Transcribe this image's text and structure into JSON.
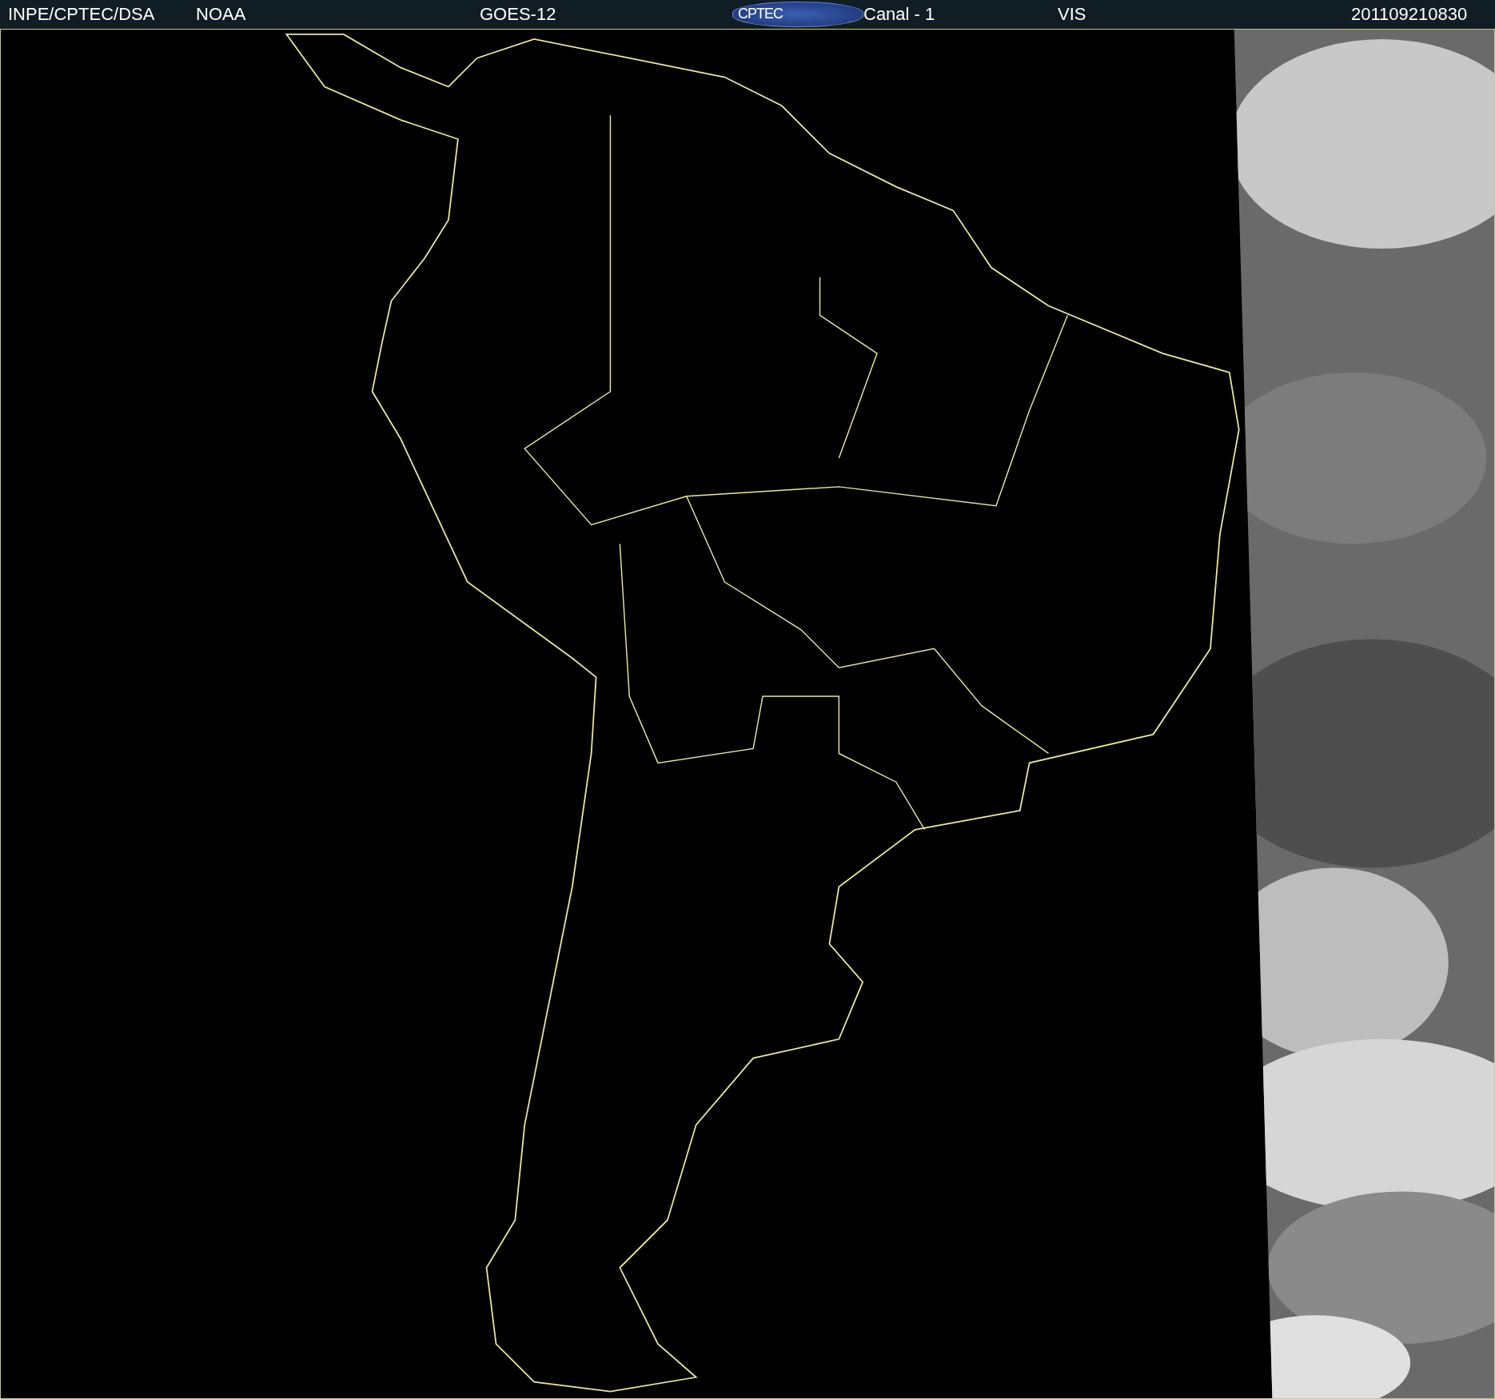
{
  "header": {
    "items": [
      {
        "text": "INPE/CPTEC/DSA"
      },
      {
        "text": "NOAA"
      },
      {
        "text": "GOES-12"
      },
      {
        "text": "CPTEC",
        "kind": "logo"
      },
      {
        "text": "Canal - 1"
      },
      {
        "text": "VIS"
      },
      {
        "text": "201109210830"
      }
    ]
  }
}
